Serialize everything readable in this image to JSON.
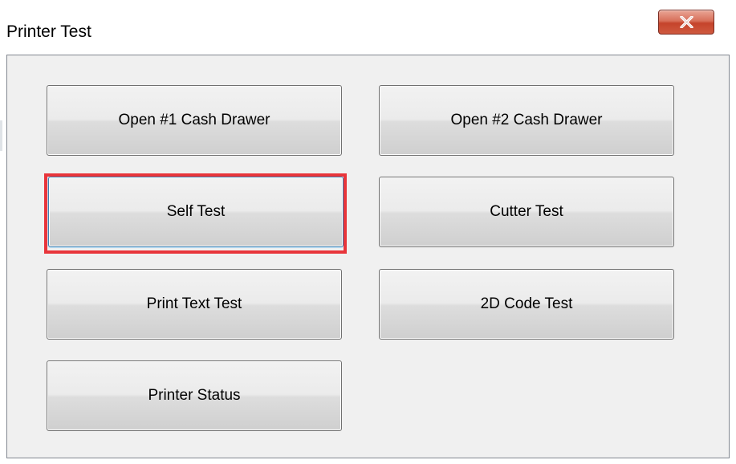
{
  "window": {
    "title": "Printer Test",
    "close_icon": "close-x-icon"
  },
  "buttons": {
    "open_drawer_1": "Open #1 Cash Drawer",
    "open_drawer_2": "Open #2 Cash Drawer",
    "self_test": "Self Test",
    "cutter_test": "Cutter Test",
    "print_text_test": "Print Text Test",
    "code_2d_test": "2D Code Test",
    "printer_status": "Printer Status"
  },
  "highlight": {
    "target": "Self Test",
    "color": "#e8353b"
  }
}
